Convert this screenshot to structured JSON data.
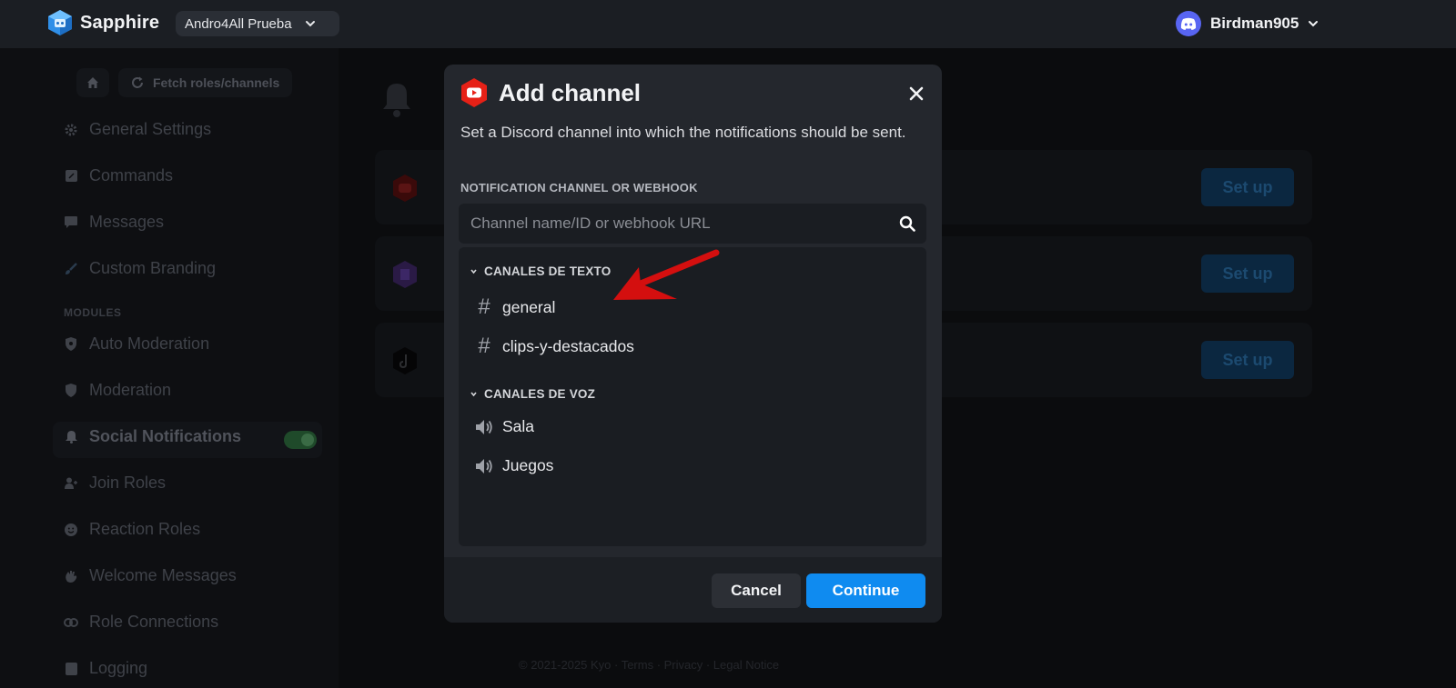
{
  "topbar": {
    "brand": "Sapphire",
    "server": "Andro4All Prueba",
    "username": "Birdman905"
  },
  "sidebar": {
    "fetch_label": "Fetch roles/channels",
    "items": [
      {
        "label": "General Settings",
        "icon": "gear-icon"
      },
      {
        "label": "Commands",
        "icon": "command-icon"
      },
      {
        "label": "Messages",
        "icon": "message-icon"
      },
      {
        "label": "Custom Branding",
        "icon": "brush-icon"
      }
    ],
    "section_label": "MODULES",
    "modules": [
      {
        "label": "Auto Moderation",
        "icon": "shield-gear-icon"
      },
      {
        "label": "Moderation",
        "icon": "shield-icon"
      },
      {
        "label": "Social Notifications",
        "icon": "bell-icon",
        "active": true,
        "enabled": true
      },
      {
        "label": "Join Roles",
        "icon": "user-plus-icon"
      },
      {
        "label": "Reaction Roles",
        "icon": "smile-icon"
      },
      {
        "label": "Welcome Messages",
        "icon": "wave-icon"
      },
      {
        "label": "Role Connections",
        "icon": "link-icon"
      },
      {
        "label": "Logging",
        "icon": "log-icon"
      }
    ]
  },
  "main": {
    "cards": [
      {
        "platform": "youtube",
        "button": "Set up"
      },
      {
        "platform": "twitch",
        "button": "Set up"
      },
      {
        "platform": "tiktok",
        "button": "Set up"
      }
    ],
    "footer": "© 2021-2025 Kyo · Terms · Privacy · Legal Notice"
  },
  "modal": {
    "title": "Add channel",
    "description": "Set a Discord channel into which the notifications should be sent.",
    "field_label": "NOTIFICATION CHANNEL OR WEBHOOK",
    "search_placeholder": "Channel name/ID or webhook URL",
    "categories": [
      {
        "name": "CANALES DE TEXTO",
        "channels": [
          "general",
          "clips-y-destacados"
        ]
      },
      {
        "name": "CANALES DE VOZ",
        "channels": [
          "Sala",
          "Juegos"
        ]
      }
    ],
    "cancel_label": "Cancel",
    "continue_label": "Continue"
  },
  "colors": {
    "accent": "#0f8bf0",
    "youtube": "#e62117",
    "annotation_arrow": "#d40f0f"
  }
}
